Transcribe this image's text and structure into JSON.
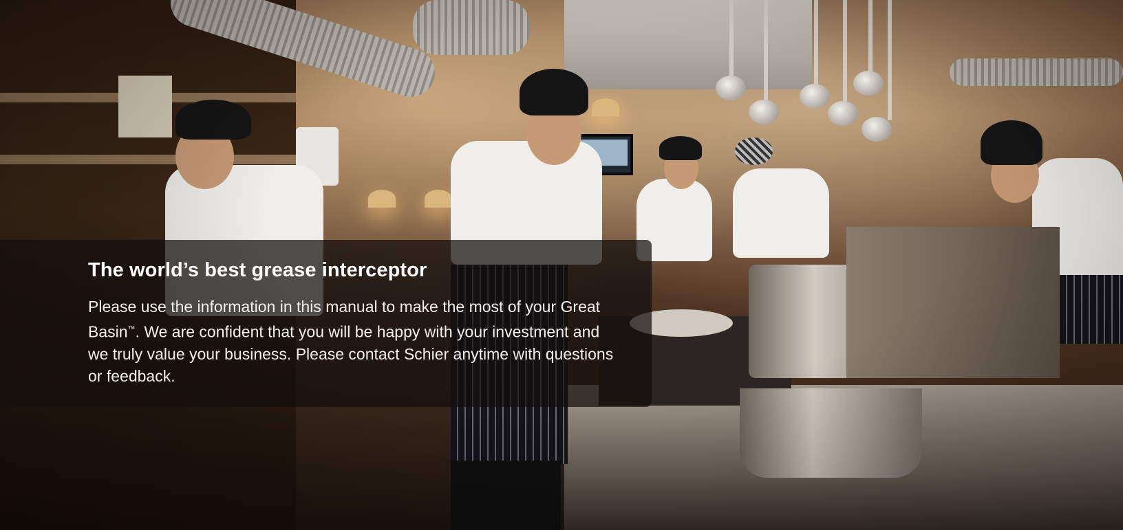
{
  "hero": {
    "image_description_name": "kitchen-background-image",
    "overlay": {
      "headline": "The world’s best grease interceptor",
      "body_part1": "Please use the information in this manual to make the most of your Great Basin",
      "trademark": "™",
      "body_part2": ". We are confident that you will be happy with your investment and we truly value your business. Please contact Schier anytime with questions or feedback."
    }
  },
  "colors": {
    "overlay_background": "rgba(18,14,12,0.72)",
    "headline_text": "#ffffff",
    "body_text": "#f2f0ec"
  }
}
